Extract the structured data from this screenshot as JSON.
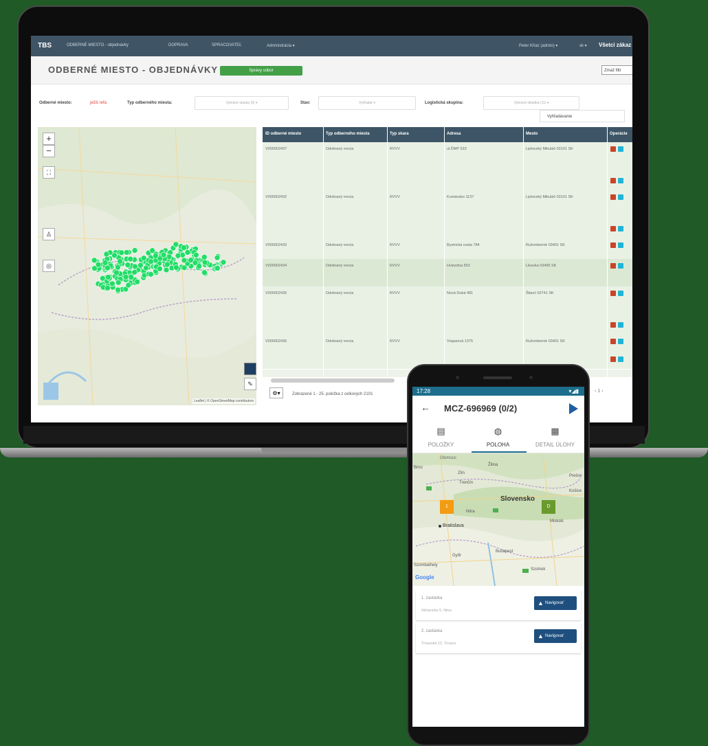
{
  "laptop": {
    "nav": {
      "brand": "TBS",
      "items": [
        "ODBERNÉ MIESTO - objednávky",
        "DOPRAVA",
        "SPRACOVATEĽ",
        "Administrácia ▾"
      ],
      "user": "Peter Kňaz (admin) ▾",
      "lang": "sk ▾",
      "right_link": "Všetci zákaz"
    },
    "page": {
      "title": "ODBERNÉ MIESTO - OBJEDNÁVKY",
      "green_button": "Správy súbor",
      "filter_button": "Zmaž filtr"
    },
    "filters": {
      "place_label": "Odberné miesto:",
      "place_value": "ježiš refa",
      "type_label": "Typ odberného miesta:",
      "type_placeholder": "Vybrané stavba (0) ▾",
      "state_label": "Stav:",
      "state_placeholder": "Vyhľadať ▾",
      "group_label": "Logistická skupina:",
      "group_placeholder": "Vybrané skladba (11) ▾",
      "search_button": "Vyhľadávanie"
    },
    "map": {
      "zoom_in": "+",
      "zoom_out": "−",
      "attribution": "Leaflet | © OpenStreetMap contributors"
    },
    "table": {
      "columns": [
        "ID odberné miesto",
        "Typ odberného miesta",
        "Typ skara",
        "Adresa",
        "Mesto",
        "Operácie"
      ],
      "rows": [
        [
          "V000002437",
          "Odobraný vrecia",
          "RVVV",
          "ul.ĎMP 533",
          "Liptovský Mikuláš 03101 SK"
        ],
        [
          "V000002432",
          "Odobraný vrecia",
          "RVVV",
          "Kumánsko 1137",
          "Liptovský Mikuláš 03101 SK"
        ],
        [
          "V000002433",
          "Odobraný vrecia",
          "RVVV",
          "Bystrická cesta 784",
          "Ružomberok 03401 SK"
        ],
        [
          "V000002434",
          "Odobraný vrecia",
          "RVVV",
          "Hviezdna 553",
          "Likavka 03495 SK"
        ],
        [
          "V000002435",
          "Odobraný vrecia",
          "RVVV",
          "Nová Dubá 481",
          "Štiavč 02741 SK"
        ],
        [
          "V000002436",
          "Odobraný vrecia",
          "RVVV",
          "Vrajasová 1375",
          "Ružomberok 03401 SK"
        ]
      ],
      "gear": "⚙▾",
      "footer_text": "Zobrazené 1 - 25. položka z celkových 2101",
      "pager": "‹  1  ›"
    }
  },
  "phone": {
    "status_time": "17:28",
    "status_icons": "▾◢▮",
    "title": "MCZ-696969 (0/2)",
    "tabs": [
      {
        "label": "POLOŽKY",
        "icon": "document-icon"
      },
      {
        "label": "POLOHA",
        "icon": "globe-icon"
      },
      {
        "label": "DETAIL ÚLOHY",
        "icon": "clipboard-icon"
      }
    ],
    "active_tab": "POLOHA",
    "map_labels": {
      "olomouc": "Olomouc",
      "zilina": "Žilina",
      "zlin": "Zlín",
      "brno": "Brno",
      "presov": "Prešov",
      "kosice": "Košice",
      "trencin": "Trenčín",
      "slovensko": "Slovensko",
      "nitra": "Nitra",
      "bratislava": "Bratislava",
      "miskolc": "Miskolc",
      "budapest": "Budapest",
      "gyor": "Győr",
      "szolnok": "Szolnok",
      "szombathely": "Szombathely",
      "google": "Google",
      "pin1": "1",
      "pin2": "D"
    },
    "cards": [
      {
        "title": "1. zastávka",
        "subtitle": "Nitrianska 5, Nitra",
        "button": "Navigovať"
      },
      {
        "title": "2. zastávka",
        "subtitle": "Trnavská 12, Trnava",
        "button": "Navigovať"
      }
    ]
  },
  "colors": {
    "background": "#1f5a27",
    "nav": "#3f5566",
    "accent_green": "#43a047",
    "markers": "#22dd66",
    "phone_status": "#1c6e8c",
    "nav_button": "#1f4f7e"
  }
}
